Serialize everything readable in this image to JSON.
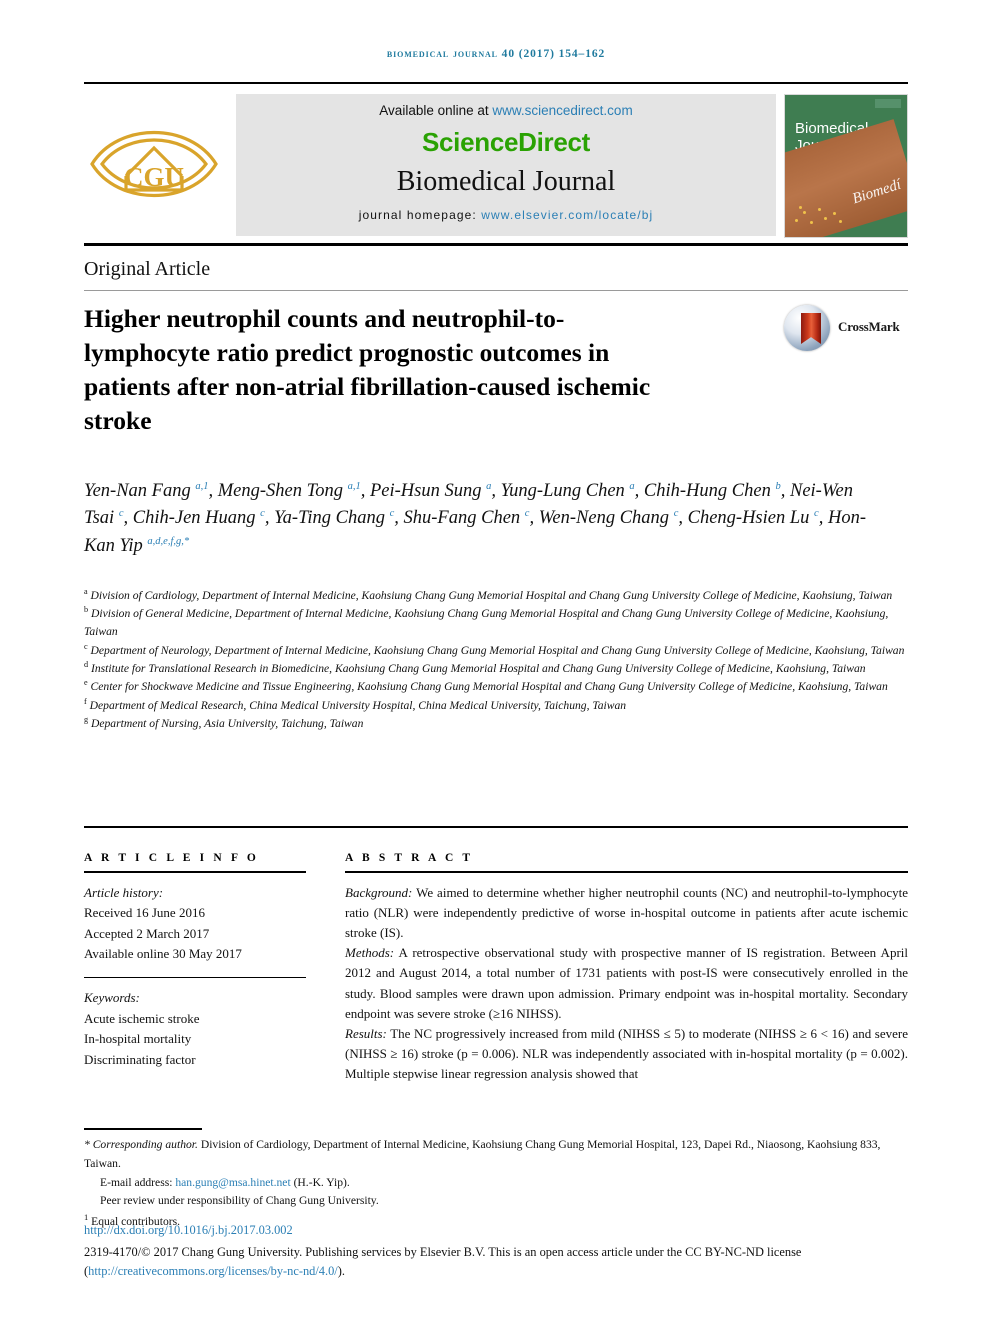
{
  "running_head": "Biomedical Journal 40 (2017) 154–162",
  "masthead": {
    "available_prefix": "Available online at ",
    "sciencedirect_url": "www.sciencedirect.com",
    "sciencedirect_logo": "ScienceDirect",
    "journal_name": "Biomedical Journal",
    "homepage_label": "journal homepage:",
    "homepage_url": "www.elsevier.com/locate/bj",
    "logo_text": "CGU",
    "cover_title_line1": "Biomedical",
    "cover_title_line2": "Journal",
    "cover_script": "Biomedí",
    "colors": {
      "band_background": "#e4e4e4",
      "sciencedirect_green": "#2aa203",
      "link_blue": "#2b7fb5",
      "running_head_blue": "#1f7a9e",
      "logo_gold": "#d9a42b",
      "cover_green": "#3f7d51",
      "cover_brown": "#a8643a"
    }
  },
  "article": {
    "type": "Original Article",
    "title": "Higher neutrophil counts and neutrophil-to-lymphocyte ratio predict prognostic outcomes in patients after non-atrial fibrillation-caused ischemic stroke",
    "crossmark_label": "CrossMark"
  },
  "authors": [
    {
      "name": "Yen-Nan Fang",
      "sup": "a,1",
      "sep": ", "
    },
    {
      "name": "Meng-Shen Tong",
      "sup": "a,1",
      "sep": ", "
    },
    {
      "name": "Pei-Hsun Sung",
      "sup": "a",
      "sep": ", "
    },
    {
      "name": "Yung-Lung Chen",
      "sup": "a",
      "sep": ", "
    },
    {
      "name": "Chih-Hung Chen",
      "sup": "b",
      "sep": ", "
    },
    {
      "name": "Nei-Wen Tsai",
      "sup": "c",
      "sep": ", "
    },
    {
      "name": "Chih-Jen Huang",
      "sup": "c",
      "sep": ", "
    },
    {
      "name": "Ya-Ting Chang",
      "sup": "c",
      "sep": ", "
    },
    {
      "name": "Shu-Fang Chen",
      "sup": "c",
      "sep": ", "
    },
    {
      "name": "Wen-Neng Chang",
      "sup": "c",
      "sep": ", "
    },
    {
      "name": "Cheng-Hsien Lu",
      "sup": "c",
      "sep": ", "
    },
    {
      "name": "Hon-Kan Yip",
      "sup": "a,d,e,f,g,*",
      "sep": ""
    }
  ],
  "affiliations": [
    {
      "marker": "a",
      "text": "Division of Cardiology, Department of Internal Medicine, Kaohsiung Chang Gung Memorial Hospital and Chang Gung University College of Medicine, Kaohsiung, Taiwan"
    },
    {
      "marker": "b",
      "text": "Division of General Medicine, Department of Internal Medicine, Kaohsiung Chang Gung Memorial Hospital and Chang Gung University College of Medicine, Kaohsiung, Taiwan"
    },
    {
      "marker": "c",
      "text": "Department of Neurology, Department of Internal Medicine, Kaohsiung Chang Gung Memorial Hospital and Chang Gung University College of Medicine, Kaohsiung, Taiwan"
    },
    {
      "marker": "d",
      "text": "Institute for Translational Research in Biomedicine, Kaohsiung Chang Gung Memorial Hospital and Chang Gung University College of Medicine, Kaohsiung, Taiwan"
    },
    {
      "marker": "e",
      "text": "Center for Shockwave Medicine and Tissue Engineering, Kaohsiung Chang Gung Memorial Hospital and Chang Gung University College of Medicine, Kaohsiung, Taiwan"
    },
    {
      "marker": "f",
      "text": "Department of Medical Research, China Medical University Hospital, China Medical University, Taichung, Taiwan"
    },
    {
      "marker": "g",
      "text": "Department of Nursing, Asia University, Taichung, Taiwan"
    }
  ],
  "article_info": {
    "heading": "A R T I C L E  I N F O",
    "history_label": "Article history:",
    "history": [
      "Received 16 June 2016",
      "Accepted 2 March 2017",
      "Available online 30 May 2017"
    ],
    "keywords_label": "Keywords:",
    "keywords": [
      "Acute ischemic stroke",
      "In-hospital mortality",
      "Discriminating factor"
    ]
  },
  "abstract": {
    "heading": "A B S T R A C T",
    "sections": [
      {
        "label": "Background:",
        "text": " We aimed to determine whether higher neutrophil counts (NC) and neutrophil-to-lymphocyte ratio (NLR) were independently predictive of worse in-hospital outcome in patients after acute ischemic stroke (IS)."
      },
      {
        "label": "Methods:",
        "text": " A retrospective observational study with prospective manner of IS registration. Between April 2012 and August 2014, a total number of 1731 patients with post-IS were consecutively enrolled in the study. Blood samples were drawn upon admission. Primary endpoint was in-hospital mortality. Secondary endpoint was severe stroke (≥16 NIHSS)."
      },
      {
        "label": "Results:",
        "text": " The NC progressively increased from mild (NIHSS ≤ 5) to moderate (NIHSS ≥ 6 < 16) and severe (NIHSS ≥ 16) stroke (p = 0.006). NLR was independently associated with in-hospital mortality (p = 0.002). Multiple stepwise linear regression analysis showed that"
      }
    ]
  },
  "footnotes": {
    "corresponding_label": "* Corresponding author.",
    "corresponding_text": " Division of Cardiology, Department of Internal Medicine, Kaohsiung Chang Gung Memorial Hospital, 123, Dapei Rd., Niaosong, Kaohsiung 833, Taiwan.",
    "email_label": "E-mail address: ",
    "email": "han.gung@msa.hinet.net",
    "email_suffix": " (H.-K. Yip).",
    "peer_review": "Peer review under responsibility of Chang Gung University.",
    "equal_marker": "1",
    "equal_text": " Equal contributors."
  },
  "publication": {
    "doi_url": "http://dx.doi.org/10.1016/j.bj.2017.03.002",
    "copyright_line": "2319-4170/© 2017 Chang Gung University. Publishing services by Elsevier B.V. This is an open access article under the CC BY-NC-ND license (",
    "license_url": "http://creativecommons.org/licenses/by-nc-nd/4.0/",
    "copyright_tail": ")."
  }
}
